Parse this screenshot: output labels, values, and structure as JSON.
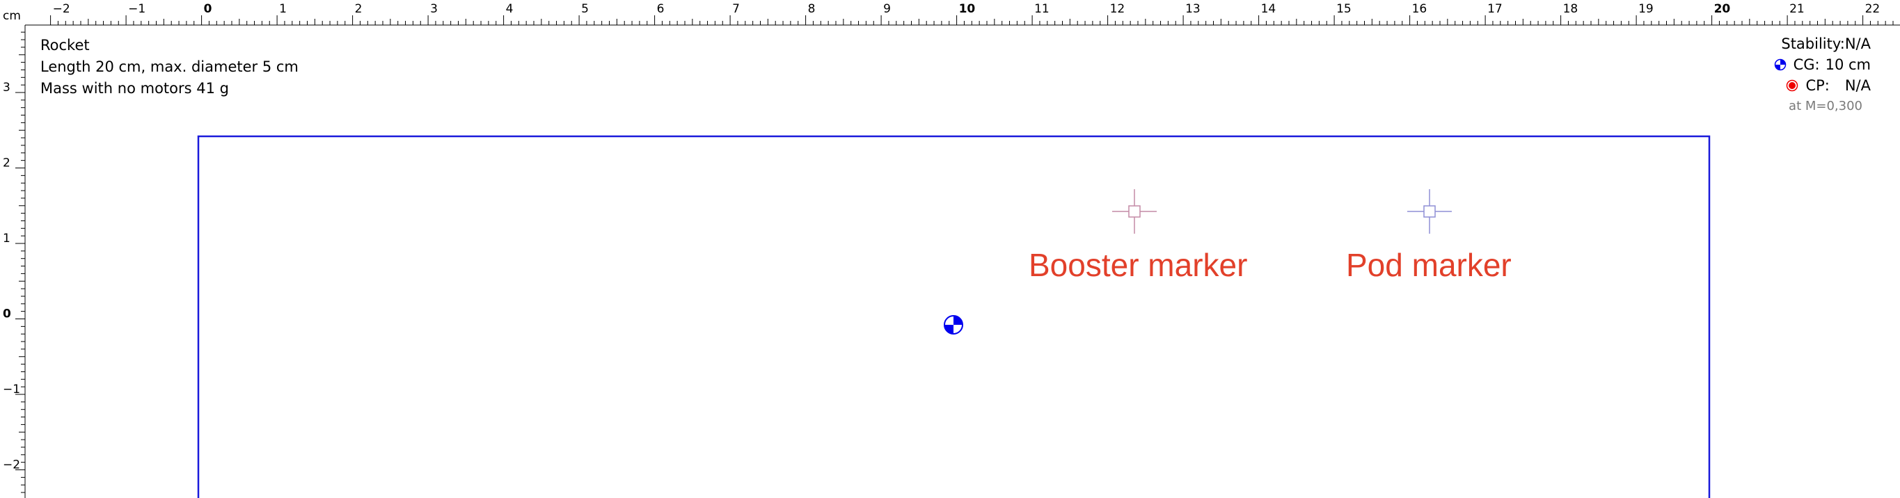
{
  "ruler": {
    "unit_label": "cm",
    "h_labels": [
      "−2",
      "−1",
      "0",
      "1",
      "2",
      "3",
      "4",
      "5",
      "6",
      "7",
      "8",
      "9",
      "10",
      "11",
      "12",
      "13",
      "14",
      "15",
      "16",
      "17",
      "18",
      "19",
      "20",
      "21",
      "22"
    ],
    "v_labels": [
      "3",
      "2",
      "1",
      "0",
      "−1",
      "−2"
    ]
  },
  "rocket_info": {
    "name": "Rocket",
    "length_line": "Length 20 cm, max. diameter 5 cm",
    "mass_line": "Mass with no motors 41 g"
  },
  "stability": {
    "label": "Stability:",
    "value": "N/A",
    "cg_label": "CG:",
    "cg_value": "10 cm",
    "cp_label": "CP:",
    "cp_value": "N/A",
    "mach_note": "at M=0,300"
  },
  "markers": {
    "booster_label": "Booster marker",
    "pod_label": "Pod marker"
  },
  "colors": {
    "outline": "#1a1adb",
    "marker_text": "#e2402a",
    "booster_cross": "#c48aa6",
    "pod_cross": "#8f8fd6",
    "cg_fill": "#0000ee",
    "cp_fill": "#ee0000"
  }
}
